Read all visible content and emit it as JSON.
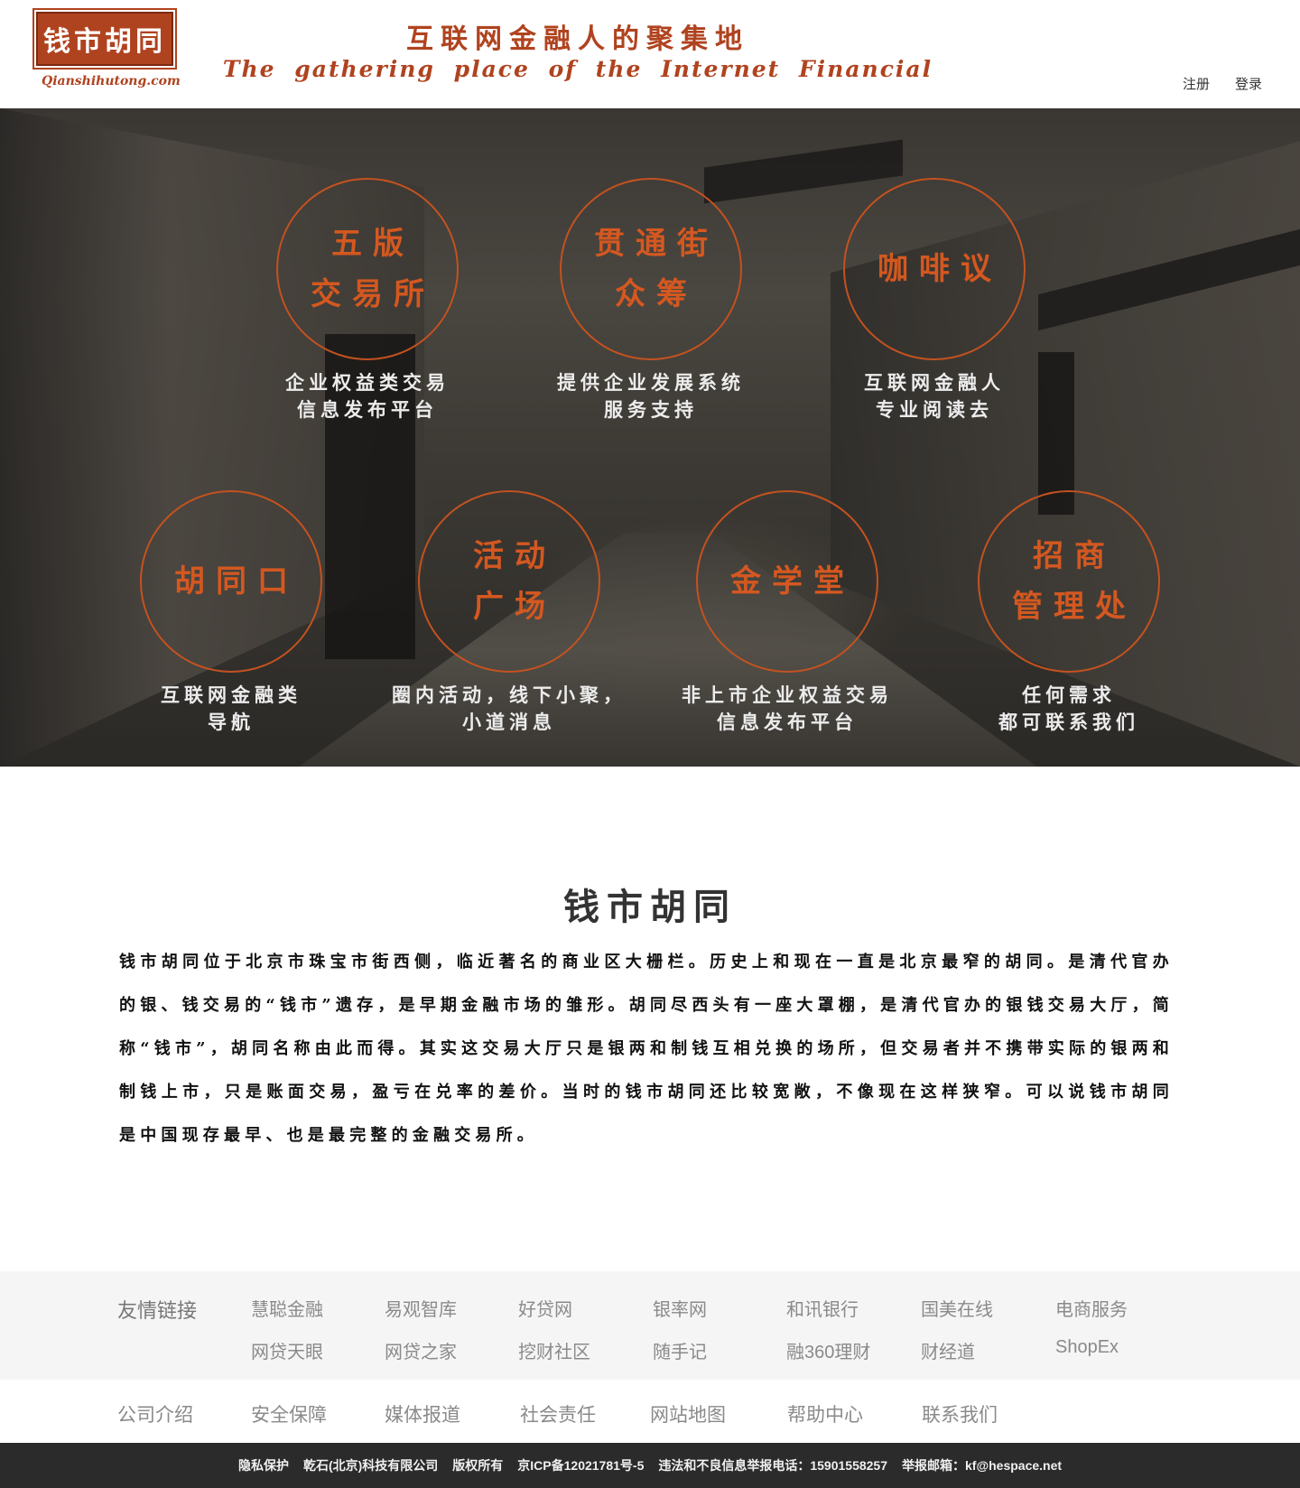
{
  "header": {
    "logo_text": "钱市胡同",
    "logo_sub": "Qianshihutong.com",
    "slogan_cn": "互联网金融人的聚集地",
    "slogan_en": "The gathering place of the Internet Financial",
    "register": "注册",
    "login": "登录"
  },
  "features": [
    {
      "line1": "五版",
      "line2": "交易所",
      "desc1": "企业权益类交易",
      "desc2": "信息发布平台"
    },
    {
      "line1": "贯通街",
      "line2": "众筹",
      "desc1": "提供企业发展系统",
      "desc2": "服务支持"
    },
    {
      "line1": "咖啡议",
      "line2": "",
      "desc1": "互联网金融人",
      "desc2": "专业阅读去"
    },
    {
      "line1": "胡同口",
      "line2": "",
      "desc1": "互联网金融类",
      "desc2": "导航"
    },
    {
      "line1": "活动",
      "line2": "广场",
      "desc1": "圈内活动，线下小聚，",
      "desc2": "小道消息"
    },
    {
      "line1": "金学堂",
      "line2": "",
      "desc1": "非上市企业权益交易",
      "desc2": "信息发布平台"
    },
    {
      "line1": "招商",
      "line2": "管理处",
      "desc1": "任何需求",
      "desc2": "都可联系我们"
    }
  ],
  "about": {
    "title": "钱市胡同",
    "body": "钱市胡同位于北京市珠宝市街西侧，临近著名的商业区大栅栏。历史上和现在一直是北京最窄的胡同。是清代官办的银、钱交易的“钱市”遗存，是早期金融市场的雏形。胡同尽西头有一座大罩棚，是清代官办的银钱交易大厅，简称“钱市”，胡同名称由此而得。其实这交易大厅只是银两和制钱互相兑换的场所，但交易者并不携带实际的银两和制钱上市，只是账面交易，盈亏在兑率的差价。当时的钱市胡同还比较宽敞，不像现在这样狭窄。可以说钱市胡同是中国现存最早、也是最完整的金融交易所。"
  },
  "friend_links": {
    "title": "友情链接",
    "row1": [
      "慧聪金融",
      "易观智库",
      "好贷网",
      "银率网",
      "和讯银行",
      "国美在线",
      "电商服务"
    ],
    "row2": [
      "网贷天眼",
      "网贷之家",
      "挖财社区",
      "随手记",
      "融360理财",
      "财经道",
      "ShopEx"
    ]
  },
  "bottom_nav": [
    "公司介绍",
    "安全保障",
    "媒体报道",
    "社会责任",
    "网站地图",
    "帮助中心",
    "联系我们"
  ],
  "copyright": [
    "隐私保护",
    "乾石(北京)科技有限公司",
    "版权所有",
    "京ICP备12021781号-5",
    "违法和不良信息举报电话：15901558257",
    "举报邮箱：kf@hespace.net"
  ],
  "colors": {
    "brand": "#b0431f",
    "circle": "#c4521f",
    "footer_bg": "#2b2b2b"
  }
}
